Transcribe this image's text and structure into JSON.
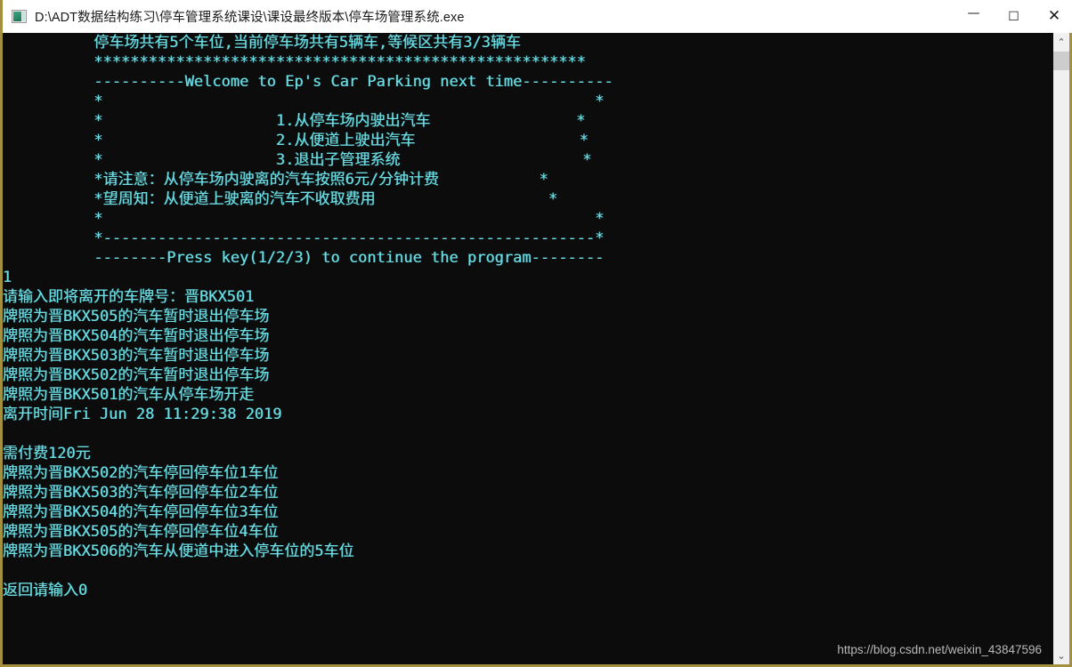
{
  "window": {
    "title": "D:\\ADT数据结构练习\\停车管理系统课设\\课设最终版本\\停车场管理系统.exe",
    "icon_name": "console-app-icon",
    "controls": {
      "minimize": "—",
      "maximize": "☐",
      "close": "✕"
    },
    "border_color": "#a38f3d",
    "titlebar_background": "#ffffff"
  },
  "console": {
    "background_color": "#0c0c0c",
    "text_color": "#6fdde2",
    "font_size_px": 17,
    "line_height_px": 22,
    "content": "          停车场共有5个车位,当前停车场共有5辆车,等候区共有3/3辆车\n          ******************************************************\n          ----------Welcome to Ep's Car Parking next time----------\n          *                                                      *\n          *                   1.从停车场内驶出汽车                *\n          *                   2.从便道上驶出汽车                  *\n          *                   3.退出子管理系统                    *\n          *请注意：从停车场内驶离的汽车按照6元/分钟计费           *\n          *望周知：从便道上驶离的汽车不收取费用                   *\n          *                                                      *\n          *------------------------------------------------------*\n          --------Press key(1/2/3) to continue the program--------\n1\n请输入即将离开的车牌号：晋BKX501\n牌照为晋BKX505的汽车暂时退出停车场\n牌照为晋BKX504的汽车暂时退出停车场\n牌照为晋BKX503的汽车暂时退出停车场\n牌照为晋BKX502的汽车暂时退出停车场\n牌照为晋BKX501的汽车从停车场开走\n离开时间Fri Jun 28 11:29:38 2019\n\n需付费120元\n牌照为晋BKX502的汽车停回停车位1车位\n牌照为晋BKX503的汽车停回停车位2车位\n牌照为晋BKX504的汽车停回停车位3车位\n牌照为晋BKX505的汽车停回停车位4车位\n牌照为晋BKX506的汽车从便道中进入停车位的5车位\n\n返回请输入0",
    "lines": [
      "          停车场共有5个车位,当前停车场共有5辆车,等候区共有3/3辆车",
      "          ******************************************************",
      "          ----------Welcome to Ep's Car Parking next time----------",
      "          *                                                      *",
      "          *                   1.从停车场内驶出汽车                *",
      "          *                   2.从便道上驶出汽车                  *",
      "          *                   3.退出子管理系统                    *",
      "          *请注意：从停车场内驶离的汽车按照6元/分钟计费           *",
      "          *望周知：从便道上驶离的汽车不收取费用                   *",
      "          *                                                      *",
      "          *------------------------------------------------------*",
      "          --------Press key(1/2/3) to continue the program--------",
      "1",
      "请输入即将离开的车牌号：晋BKX501",
      "牌照为晋BKX505的汽车暂时退出停车场",
      "牌照为晋BKX504的汽车暂时退出停车场",
      "牌照为晋BKX503的汽车暂时退出停车场",
      "牌照为晋BKX502的汽车暂时退出停车场",
      "牌照为晋BKX501的汽车从停车场开走",
      "离开时间Fri Jun 28 11:29:38 2019",
      "",
      "需付费120元",
      "牌照为晋BKX502的汽车停回停车位1车位",
      "牌照为晋BKX503的汽车停回停车位2车位",
      "牌照为晋BKX504的汽车停回停车位3车位",
      "牌照为晋BKX505的汽车停回停车位4车位",
      "牌照为晋BKX506的汽车从便道中进入停车位的5车位",
      "",
      "返回请输入0"
    ],
    "status_line": "停车场共有5个车位,当前停车场共有5辆车,等候区共有3/3辆车",
    "banner": "----------Welcome to Ep's Car Parking next time----------",
    "menu_items": [
      "1.从停车场内驶出汽车",
      "2.从便道上驶出汽车",
      "3.退出子管理系统"
    ],
    "notes": [
      "请注意：从停车场内驶离的汽车按照6元/分钟计费",
      "望周知：从便道上驶离的汽车不收取费用"
    ],
    "prompt": "--------Press key(1/2/3) to continue the program--------",
    "user_input": "1",
    "plate_prompt": "请输入即将离开的车牌号：晋BKX501",
    "leave_time": "离开时间Fri Jun 28 11:29:38 2019",
    "fee": "需付费120元",
    "return_prompt": "返回请输入0"
  },
  "watermark": {
    "text": "https://blog.csdn.net/weixin_43847596"
  },
  "scrollbar": {
    "up_arrow": "⌃",
    "down_arrow": "⌄",
    "thumb_name": "scrollbar-thumb"
  }
}
